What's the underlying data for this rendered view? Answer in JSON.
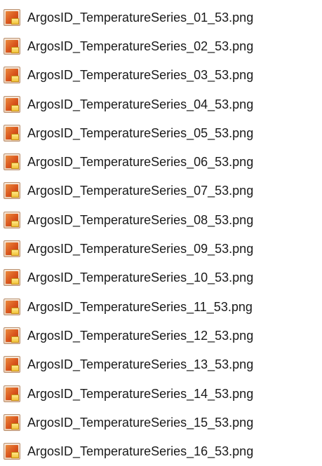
{
  "file_list": {
    "icon": "image-file-icon",
    "items": [
      {
        "name": "ArgosID_TemperatureSeries_01_53.png"
      },
      {
        "name": "ArgosID_TemperatureSeries_02_53.png"
      },
      {
        "name": "ArgosID_TemperatureSeries_03_53.png"
      },
      {
        "name": "ArgosID_TemperatureSeries_04_53.png"
      },
      {
        "name": "ArgosID_TemperatureSeries_05_53.png"
      },
      {
        "name": "ArgosID_TemperatureSeries_06_53.png"
      },
      {
        "name": "ArgosID_TemperatureSeries_07_53.png"
      },
      {
        "name": "ArgosID_TemperatureSeries_08_53.png"
      },
      {
        "name": "ArgosID_TemperatureSeries_09_53.png"
      },
      {
        "name": "ArgosID_TemperatureSeries_10_53.png"
      },
      {
        "name": "ArgosID_TemperatureSeries_11_53.png"
      },
      {
        "name": "ArgosID_TemperatureSeries_12_53.png"
      },
      {
        "name": "ArgosID_TemperatureSeries_13_53.png"
      },
      {
        "name": "ArgosID_TemperatureSeries_14_53.png"
      },
      {
        "name": "ArgosID_TemperatureSeries_15_53.png"
      },
      {
        "name": "ArgosID_TemperatureSeries_16_53.png"
      }
    ]
  }
}
